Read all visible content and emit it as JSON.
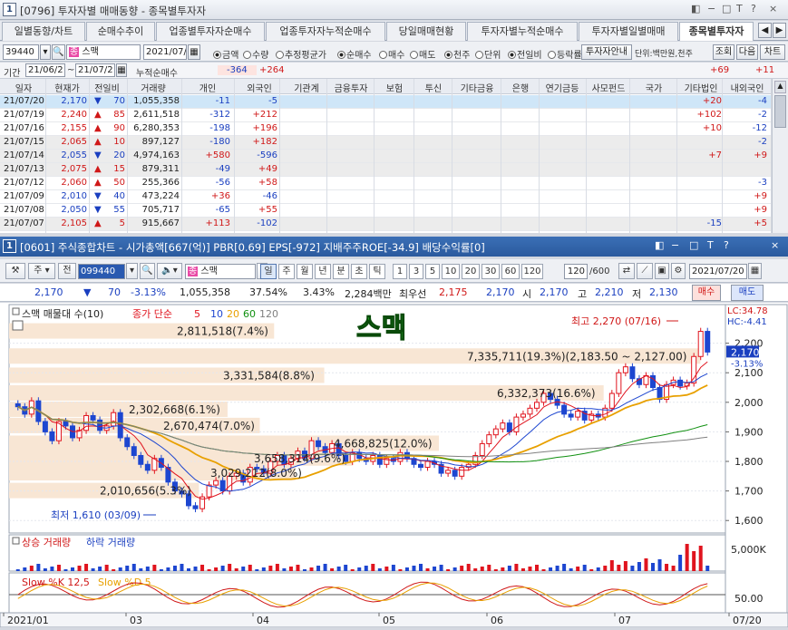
{
  "win1": {
    "title": "[0796] 투자자별 매매동향 - 종목별투자자",
    "no": "1",
    "controls": [
      "◧",
      "−",
      "□",
      "T",
      "?",
      "×"
    ]
  },
  "tabs": [
    "일별동향/차트",
    "순매수추이",
    "업종별투자자순매수",
    "업종투자자누적순매수",
    "당일매매현황",
    "투자자별누적순매수",
    "투자자별일별매매",
    "종목별투자자"
  ],
  "toolbar": {
    "code": "39440",
    "stock": "스맥",
    "date": "2021/07/2",
    "radios": [
      "금액",
      "수량",
      "추정평균가",
      "순매수",
      "매수",
      "매도",
      "천주",
      "단위",
      "전일비",
      "등락률"
    ],
    "invest_btn": "투자자안내",
    "unit": "단위:백만원,천주",
    "btn_query": "조회",
    "btn_next": "다음",
    "btn_chart": "차트"
  },
  "period": {
    "label": "기간",
    "from": "21/06/2",
    "to": "21/07/2",
    "label2": "누적순매수",
    "v_indiv": "-364",
    "v_foreign": "+264",
    "v_bank": "+69",
    "v_other": "+11"
  },
  "headers": [
    "일자",
    "현재가",
    "전일비",
    "거래량",
    "개인",
    "외국인",
    "기관계",
    "금융투자",
    "보험",
    "투신",
    "기타금융",
    "은행",
    "연기금등",
    "사모펀드",
    "국가",
    "기타법인",
    "내외국인"
  ],
  "rows": [
    {
      "date": "21/07/20",
      "price": "2,170",
      "dir": "down",
      "chg": "70",
      "vol": "1,055,358",
      "indiv": "-11",
      "foreign": "-5",
      "corp": "+20",
      "inout": "-4"
    },
    {
      "date": "21/07/19",
      "price": "2,240",
      "dir": "up",
      "chg": "85",
      "vol": "2,611,518",
      "indiv": "-312",
      "foreign": "+212",
      "corp": "+102",
      "inout": "-2"
    },
    {
      "date": "21/07/16",
      "price": "2,155",
      "dir": "up",
      "chg": "90",
      "vol": "6,280,353",
      "indiv": "-198",
      "foreign": "+196",
      "corp": "+10",
      "inout": "-12"
    },
    {
      "date": "21/07/15",
      "price": "2,065",
      "dir": "up",
      "chg": "10",
      "vol": "897,127",
      "indiv": "-180",
      "foreign": "+182",
      "corp": "",
      "inout": "-2"
    },
    {
      "date": "21/07/14",
      "price": "2,055",
      "dir": "down",
      "chg": "20",
      "vol": "4,974,163",
      "indiv": "+580",
      "foreign": "-596",
      "corp": "+7",
      "inout": "+9"
    },
    {
      "date": "21/07/13",
      "price": "2,075",
      "dir": "up",
      "chg": "15",
      "vol": "879,311",
      "indiv": "-49",
      "foreign": "+49",
      "corp": "",
      "inout": ""
    },
    {
      "date": "21/07/12",
      "price": "2,060",
      "dir": "up",
      "chg": "50",
      "vol": "255,366",
      "indiv": "-56",
      "foreign": "+58",
      "corp": "",
      "inout": "-3"
    },
    {
      "date": "21/07/09",
      "price": "2,010",
      "dir": "down",
      "chg": "40",
      "vol": "473,224",
      "indiv": "+36",
      "foreign": "-46",
      "corp": "",
      "inout": "+9"
    },
    {
      "date": "21/07/08",
      "price": "2,050",
      "dir": "down",
      "chg": "55",
      "vol": "705,717",
      "indiv": "-65",
      "foreign": "+55",
      "corp": "",
      "inout": "+9"
    },
    {
      "date": "21/07/07",
      "price": "2,105",
      "dir": "up",
      "chg": "5",
      "vol": "915,667",
      "indiv": "+113",
      "foreign": "-102",
      "corp": "-15",
      "inout": "+5"
    }
  ],
  "win2": {
    "title": "[0601] 주식종합차트 - 시가총액[667(억)] PBR[0.69] EPS[-972] 지배주주ROE[-34.9] 배당수익률[0]",
    "no": "1",
    "controls": [
      "◧",
      "−",
      "□",
      "T",
      "?",
      "×"
    ]
  },
  "tb2": {
    "code": "099440",
    "stock": "스맥",
    "periods": [
      "일",
      "주",
      "월",
      "년",
      "분",
      "초",
      "틱"
    ],
    "nums": [
      "1",
      "3",
      "5",
      "10",
      "20",
      "30",
      "60",
      "120"
    ],
    "count": "120",
    "total": "/600",
    "date": "2021/07/20",
    "labels": {
      "ju": "주",
      "jeon": "전"
    }
  },
  "quote": {
    "price": "2,170",
    "chg": "70",
    "pct": "-3.13%",
    "vol": "1,055,358",
    "r1": "37.54%",
    "r2": "3.43%",
    "amt": "2,284백만",
    "note": "최우선",
    "ask": "2,175",
    "bid": "2,170",
    "open_l": "시",
    "open": "2,170",
    "high_l": "고",
    "high": "2,210",
    "low_l": "저",
    "low": "2,130",
    "buy": "매수",
    "sell": "매도"
  },
  "chart_title": "스맥",
  "legend": {
    "main": "스맥 매물대 수(10)",
    "ma": "종가 단순",
    "ma_vals": [
      "5",
      "10",
      "20",
      "60",
      "120"
    ]
  },
  "price_labels": {
    "hi": "최고 2,270 (07/16)",
    "lo": "최저 1,610 (03/09)",
    "lc": "LC:34.78",
    "hc": "HC:-4.41",
    "cur": "2,170",
    "cur_pct": "-3.13%"
  },
  "vp": [
    "2,811,518(7.4%)",
    "7,335,711(19.3%)(2,183.50 ~ 2,127.00)",
    "3,331,584(8.8%)",
    "6,332,373(16.6%)",
    "2,302,668(6.1%)",
    "2,670,474(7.0%)",
    "4,668,825(12.0%)",
    "3,658,314(9.6%)",
    "3,029,212(8.0%)",
    "2,010,656(5.3%)"
  ],
  "yaxis": [
    "2,200",
    "2,100",
    "2,000",
    "1,900",
    "1,800",
    "1,700",
    "1,600"
  ],
  "vol_legend": {
    "up": "상승 거래량",
    "down": "하락 거래량",
    "axis": "5,000K"
  },
  "stoch": {
    "k": "Slow %K 12,5",
    "d": "Slow %D 5",
    "axis": "50.00"
  },
  "xaxis": [
    "2021/01",
    "03",
    "04",
    "05",
    "06",
    "07",
    "07/20"
  ],
  "colors": {
    "up": "#e0141e",
    "down": "#1d46d0",
    "vp": "#f8e6d4",
    "ma5": "#e0141e",
    "ma10": "#1d46d0",
    "ma20": "#e8a000",
    "ma60": "#109010",
    "ma120": "#808080"
  },
  "chart_data": {
    "type": "candlestick",
    "ylim": [
      1570,
      2300
    ],
    "volume_profile": [
      {
        "label": "2,811,518(7.4%)",
        "price": 2240,
        "pct": 7.4
      },
      {
        "label": "7,335,711(19.3%)(2,183.50 ~ 2,127.00)",
        "price": 2155,
        "pct": 19.3
      },
      {
        "label": "3,331,584(8.8%)",
        "price": 2090,
        "pct": 8.8
      },
      {
        "label": "6,332,373(16.6%)",
        "price": 2030,
        "pct": 16.6
      },
      {
        "label": "2,302,668(6.1%)",
        "price": 1975,
        "pct": 6.1
      },
      {
        "label": "2,670,474(7.0%)",
        "price": 1920,
        "pct": 7.0
      },
      {
        "label": "4,668,825(12.0%)",
        "price": 1860,
        "pct": 12.0
      },
      {
        "label": "3,658,314(9.6%)",
        "price": 1810,
        "pct": 9.6
      },
      {
        "label": "3,029,212(8.0%)",
        "price": 1760,
        "pct": 8.0
      },
      {
        "label": "2,010,656(5.3%)",
        "price": 1700,
        "pct": 5.3
      }
    ],
    "closes": [
      1985,
      1960,
      2005,
      1935,
      1900,
      1870,
      1935,
      1920,
      1880,
      1905,
      1955,
      1940,
      1905,
      1920,
      1965,
      1880,
      1850,
      1820,
      1790,
      1770,
      1810,
      1780,
      1730,
      1700,
      1690,
      1650,
      1640,
      1680,
      1720,
      1735,
      1700,
      1750,
      1760,
      1730,
      1780,
      1775,
      1760,
      1800,
      1820,
      1790,
      1810,
      1835,
      1810,
      1870,
      1850,
      1830,
      1860,
      1820,
      1800,
      1830,
      1810,
      1800,
      1820,
      1790,
      1810,
      1800,
      1830,
      1810,
      1790,
      1780,
      1800,
      1790,
      1760,
      1770,
      1750,
      1780,
      1790,
      1820,
      1860,
      1890,
      1910,
      1930,
      1900,
      1950,
      1960,
      1980,
      2000,
      2030,
      2010,
      1990,
      1960,
      1950,
      1970,
      1940,
      1960,
      1950,
      1980,
      2030,
      2100,
      2120,
      2080,
      2060,
      2090,
      2050,
      2010,
      2060,
      2075,
      2055,
      2065,
      2155,
      2240,
      2170
    ],
    "high": 2270,
    "low": 1610
  }
}
